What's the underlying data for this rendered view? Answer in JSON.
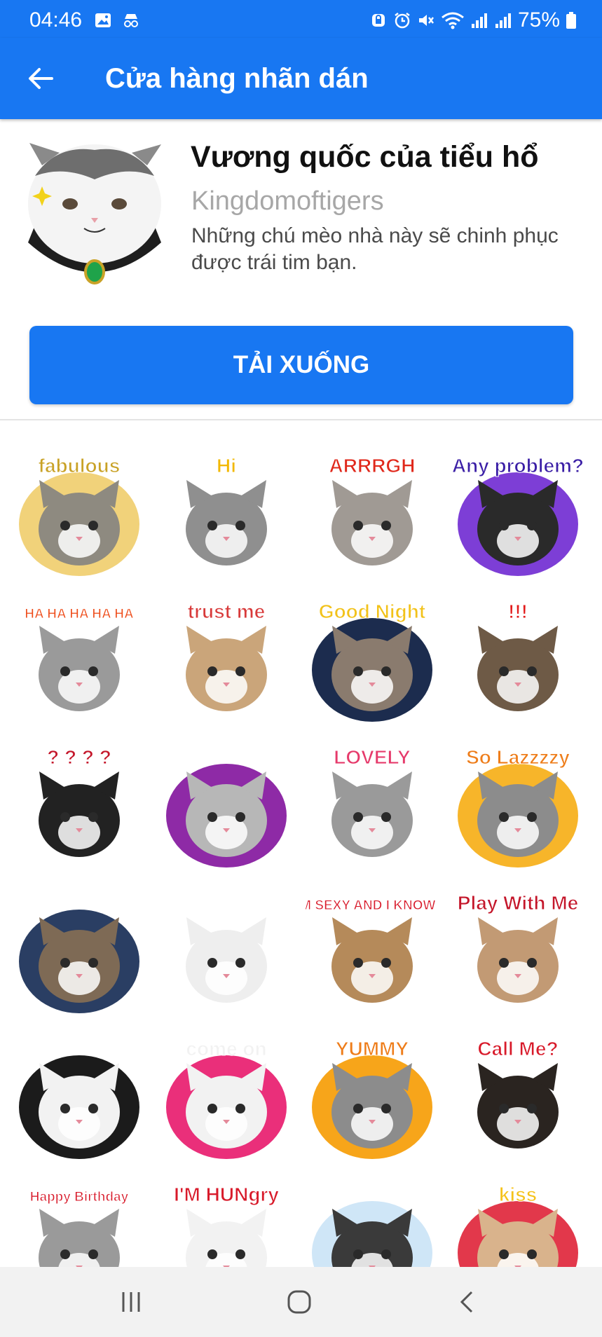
{
  "status_bar": {
    "time": "04:46",
    "battery": "75%"
  },
  "app_bar": {
    "title": "Cửa hàng nhãn dán"
  },
  "pack": {
    "title": "Vương quốc của tiểu hổ",
    "author": "Kingdomoftigers",
    "description": "Những chú mèo nhà này sẽ chinh phục được trái tim bạn.",
    "download_label": "TẢI XUỐNG"
  },
  "stickers": [
    {
      "caption": "fabulous",
      "bg": "#f1d27a",
      "accent": "#c9a227",
      "cat": "#8e8a80"
    },
    {
      "caption": "Hi",
      "bg": "#ffffff",
      "accent": "#f2b800",
      "cat": "#8f8f8f"
    },
    {
      "caption": "ARRRGH",
      "bg": "#ffffff",
      "accent": "#e0281b",
      "cat": "#a09a94"
    },
    {
      "caption": "Any problem?",
      "bg": "#7d3ed6",
      "accent": "#3b1fa6",
      "cat": "#2a2a2a"
    },
    {
      "caption": "HA HA HA HA HA",
      "bg": "#ffffff",
      "accent": "#ee4a17",
      "cat": "#9a9a9a"
    },
    {
      "caption": "trust me",
      "bg": "#ffffff",
      "accent": "#d83a3a",
      "cat": "#caa57a"
    },
    {
      "caption": "Good Night",
      "bg": "#1c2c4e",
      "accent": "#f2c21a",
      "cat": "#8a7b6e"
    },
    {
      "caption": "!!!",
      "bg": "#ffffff",
      "accent": "#e21b1b",
      "cat": "#6e5a46"
    },
    {
      "caption": "? ? ? ?",
      "bg": "#ffffff",
      "accent": "#c4162a",
      "cat": "#222222"
    },
    {
      "caption": "",
      "bg": "#8e2aa6",
      "accent": "#f2d21a",
      "cat": "#b7b7b7"
    },
    {
      "caption": "LOVELY",
      "bg": "#ffffff",
      "accent": "#e63a6b",
      "cat": "#9a9a9a"
    },
    {
      "caption": "So Lazzzzy",
      "bg": "#f7b52a",
      "accent": "#ee7d1a",
      "cat": "#8c8c8c"
    },
    {
      "caption": "",
      "bg": "#2a3e63",
      "accent": "#f0f0f0",
      "cat": "#7e6a55"
    },
    {
      "caption": "",
      "bg": "#ffffff",
      "accent": "#3a8ed1",
      "cat": "#eeeeee"
    },
    {
      "caption": "I'M SEXY AND I KNOW IT",
      "bg": "#ffffff",
      "accent": "#d81a2a",
      "cat": "#b58a5a"
    },
    {
      "caption": "Play With Me",
      "bg": "#ffffff",
      "accent": "#c4162a",
      "cat": "#c29a74"
    },
    {
      "caption": "",
      "bg": "#1b1b1b",
      "accent": "#1fa34a",
      "cat": "#f2f2f2"
    },
    {
      "caption": "come on",
      "bg": "#ea2f7a",
      "accent": "#f2f2f2",
      "cat": "#f2f2f2"
    },
    {
      "caption": "YUMMY",
      "bg": "#f7a51a",
      "accent": "#ee7d1a",
      "cat": "#8c8c8c"
    },
    {
      "caption": "Call Me?",
      "bg": "#ffffff",
      "accent": "#d81a2a",
      "cat": "#2a2420"
    },
    {
      "caption": "Happy Birthday",
      "bg": "#ffffff",
      "accent": "#d81a2a",
      "cat": "#9a9a9a"
    },
    {
      "caption": "I'M HUNgry",
      "bg": "#ffffff",
      "accent": "#d81a2a",
      "cat": "#f2f2f2"
    },
    {
      "caption": "",
      "bg": "#cfe6f7",
      "accent": "#8cbfe3",
      "cat": "#3a3a3a"
    },
    {
      "caption": "kiss",
      "bg": "#e2384b",
      "accent": "#f5c21a",
      "cat": "#d9b38c"
    }
  ],
  "icons": {
    "back": "arrow-left-icon",
    "nav_recent": "recent-apps-icon",
    "nav_home": "home-icon",
    "nav_back": "chevron-left-icon"
  }
}
